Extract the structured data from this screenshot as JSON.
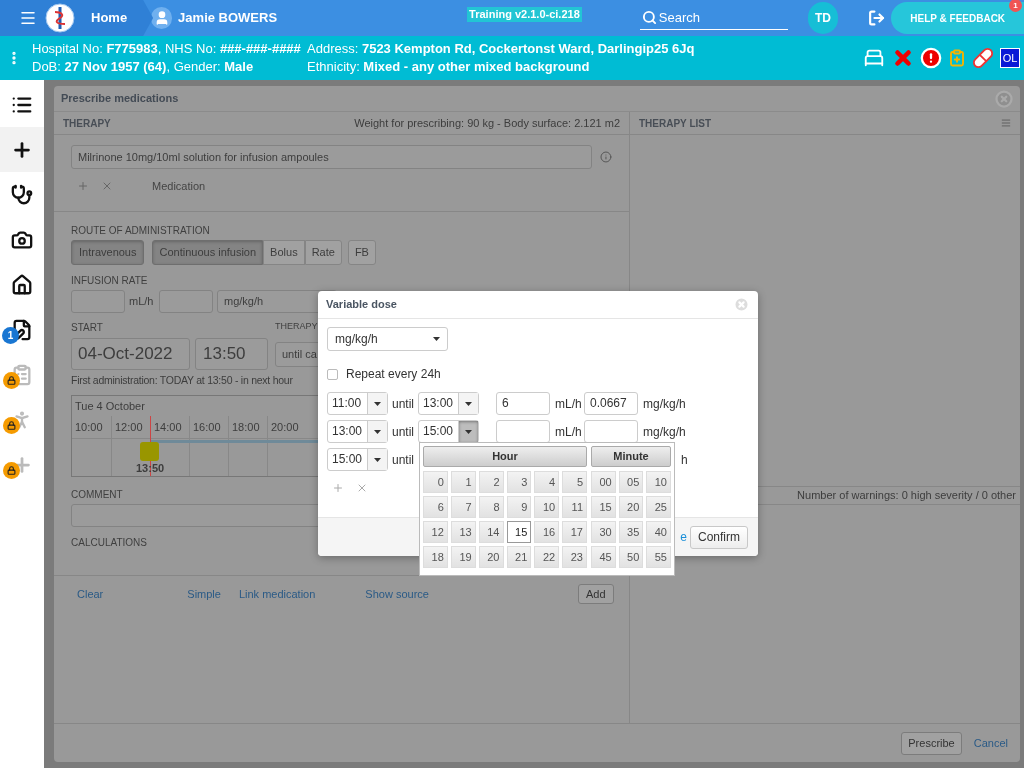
{
  "topbar": {
    "home": "Home",
    "patient_name": "Jamie BOWERS",
    "version": "Training v2.1.0-ci.218",
    "search_placeholder": "Search",
    "user_initials": "TD",
    "help": "HELP & FEEDBACK",
    "help_badge": "1"
  },
  "patient": {
    "left": [
      "Hospital No: **F775983**, NHS No: **###-###-####**",
      "DoB: **27 Nov 1957 (64)**, Gender: **Male**"
    ],
    "right": [
      "Address: **7523 Kempton Rd, Cockertonst Ward, Darlingip25 6Jq**",
      "Ethnicity: **Mixed - any other mixed background**"
    ],
    "alert_code": "OL"
  },
  "sidebar": [
    {
      "kind": "list",
      "selected": false,
      "locked": false
    },
    {
      "kind": "add",
      "selected": true,
      "locked": false
    },
    {
      "kind": "stethoscope",
      "selected": false,
      "locked": false
    },
    {
      "kind": "camera",
      "selected": false,
      "locked": false
    },
    {
      "kind": "home",
      "selected": false,
      "locked": false
    },
    {
      "kind": "edit",
      "selected": false,
      "locked": false,
      "badge": "1"
    },
    {
      "kind": "clipboard",
      "selected": false,
      "locked": true
    },
    {
      "kind": "walk",
      "selected": false,
      "locked": true
    },
    {
      "kind": "add",
      "selected": false,
      "locked": true
    }
  ],
  "dialog": {
    "title": "Prescribe medications",
    "therapy": {
      "heading": "THERAPY",
      "weight": "Weight for prescribing: 90 kg - Body surface: 2.121 m2",
      "medication": "Milrinone 10mg/10ml solution for infusion ampoules",
      "medication_label": "Medication",
      "route_label": "ROUTE OF ADMINISTRATION",
      "route": [
        {
          "label": "Intravenous",
          "selected": true
        }
      ],
      "modes": [
        {
          "label": "Continuous infusion",
          "selected": true
        },
        {
          "label": "Bolus",
          "selected": false
        },
        {
          "label": "Rate",
          "selected": false
        }
      ],
      "extra_button": "FB",
      "infusion_label": "INFUSION RATE",
      "rate_unit": "mL/h",
      "dose_unit": "mg/kg/h",
      "start_label": "START",
      "start_date": "04-Oct-2022",
      "start_time": "13:50",
      "duration_label": "THERAPY",
      "duration": "until ca",
      "first_admin": "First administration: TODAY at 13:50 - in next hour",
      "timeline": {
        "date": "Tue 4 October",
        "hours": [
          "10:00",
          "12:00",
          "14:00",
          "16:00",
          "18:00",
          "20:00"
        ],
        "marker_time": "13:50"
      },
      "comment_label": "COMMENT",
      "calculations_label": "CALCULATIONS",
      "links": [
        "Clear",
        "Simple",
        "Link medication",
        "Show source"
      ],
      "add": "Add"
    },
    "therapy_list": {
      "heading": "THERAPY LIST",
      "warnings": "Number of warnings: 0 high severity / 0 other"
    },
    "prescribe": "Prescribe",
    "cancel": "Cancel"
  },
  "variable_dose": {
    "title": "Variable dose",
    "unit": "mg/kg/h",
    "repeat": {
      "label": "Repeat every 24h",
      "checked": false
    },
    "rows": [
      {
        "from": "11:00",
        "until": "until",
        "to": "13:00",
        "open": false,
        "rate": "6",
        "rate_unit": "mL/h",
        "dose": "0.0667",
        "dose_unit": "mg/kg/h"
      },
      {
        "from": "13:00",
        "until": "until",
        "to": "15:00",
        "open": true,
        "rate_unit": "mL/h",
        "dose_unit": "mg/kg/h"
      },
      {
        "from": "15:00",
        "until": "until",
        "tail": "h"
      }
    ],
    "footer_link": "e",
    "confirm": "Confirm"
  },
  "time_picker": {
    "hour_heading": "Hour",
    "minute_heading": "Minute",
    "hours": [
      {
        "label": "0",
        "selected": false
      },
      {
        "label": "1",
        "selected": false
      },
      {
        "label": "2",
        "selected": false
      },
      {
        "label": "3",
        "selected": false
      },
      {
        "label": "4",
        "selected": false
      },
      {
        "label": "5",
        "selected": false
      },
      {
        "label": "6",
        "selected": false
      },
      {
        "label": "7",
        "selected": false
      },
      {
        "label": "8",
        "selected": false
      },
      {
        "label": "9",
        "selected": false
      },
      {
        "label": "10",
        "selected": false
      },
      {
        "label": "11",
        "selected": false
      },
      {
        "label": "12",
        "selected": false
      },
      {
        "label": "13",
        "selected": false
      },
      {
        "label": "14",
        "selected": false
      },
      {
        "label": "15",
        "selected": true
      },
      {
        "label": "16",
        "selected": false
      },
      {
        "label": "17",
        "selected": false
      },
      {
        "label": "18",
        "selected": false
      },
      {
        "label": "19",
        "selected": false
      },
      {
        "label": "20",
        "selected": false
      },
      {
        "label": "21",
        "selected": false
      },
      {
        "label": "22",
        "selected": false
      },
      {
        "label": "23",
        "selected": false
      }
    ],
    "minutes": [
      {
        "label": "00",
        "selected": false
      },
      {
        "label": "05",
        "selected": false
      },
      {
        "label": "10",
        "selected": false
      },
      {
        "label": "15",
        "selected": false
      },
      {
        "label": "20",
        "selected": false
      },
      {
        "label": "25",
        "selected": false
      },
      {
        "label": "30",
        "selected": false
      },
      {
        "label": "35",
        "selected": false
      },
      {
        "label": "40",
        "selected": false
      },
      {
        "label": "45",
        "selected": false
      },
      {
        "label": "50",
        "selected": false
      },
      {
        "label": "55",
        "selected": false
      }
    ]
  }
}
